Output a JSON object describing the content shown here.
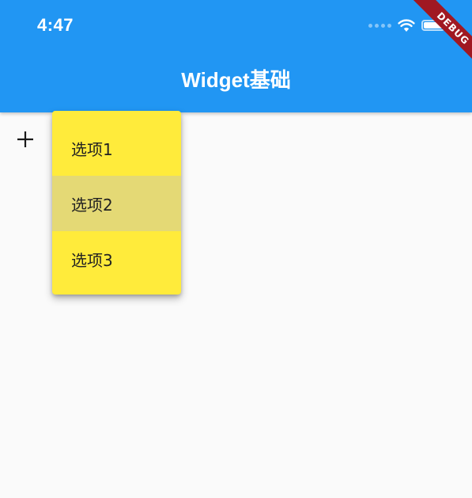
{
  "status_bar": {
    "time": "4:47"
  },
  "app_bar": {
    "title": "Widget基础"
  },
  "debug_banner": {
    "label": "DEBUG"
  },
  "popup_menu": {
    "items": [
      {
        "label": "选项1",
        "highlighted": false
      },
      {
        "label": "选项2",
        "highlighted": true
      },
      {
        "label": "选项3",
        "highlighted": false
      }
    ]
  },
  "icons": {
    "add": "add-icon",
    "wifi": "wifi-icon",
    "battery": "battery-icon"
  },
  "colors": {
    "app_bar": "#2196f3",
    "menu_background": "#ffeb3b",
    "menu_highlight": "#e4d975",
    "page_background": "#fafafa",
    "debug_banner": "#a01822"
  }
}
